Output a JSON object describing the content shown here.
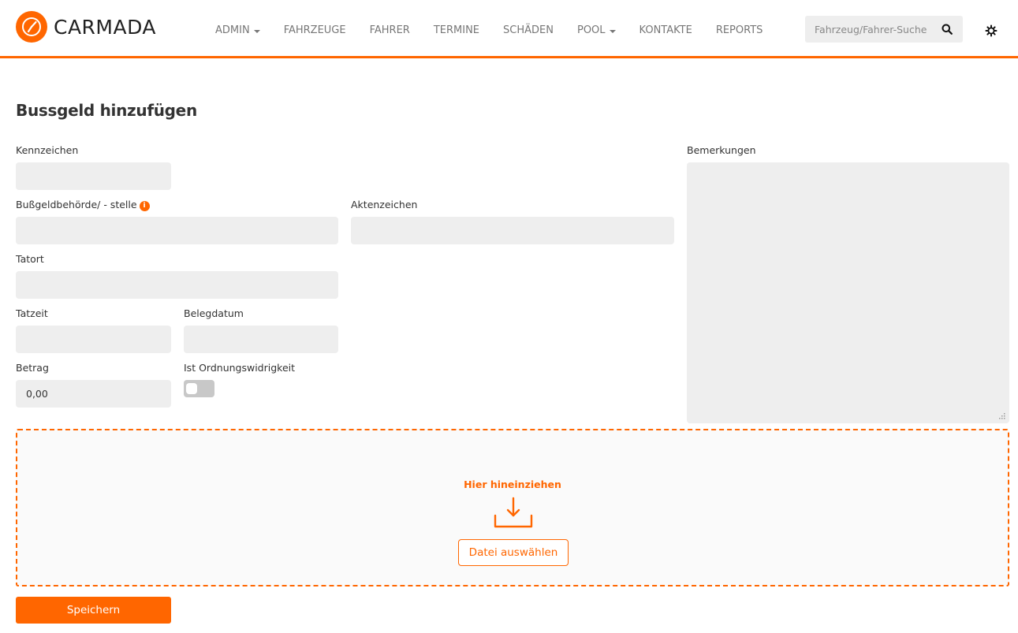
{
  "app": {
    "brand_name": "CARMADA",
    "accent_color": "#ff6600"
  },
  "nav": {
    "items": [
      {
        "label": "ADMIN",
        "dropdown": true
      },
      {
        "label": "FAHRZEUGE",
        "dropdown": false
      },
      {
        "label": "FAHRER",
        "dropdown": false
      },
      {
        "label": "TERMINE",
        "dropdown": false
      },
      {
        "label": "SCHÄDEN",
        "dropdown": false
      },
      {
        "label": "POOL",
        "dropdown": true
      },
      {
        "label": "KONTAKTE",
        "dropdown": false
      },
      {
        "label": "REPORTS",
        "dropdown": false
      }
    ]
  },
  "search": {
    "placeholder": "Fahrzeug/Fahrer-Suche",
    "value": "",
    "icon": "search-icon"
  },
  "settings": {
    "icon": "gear-icon"
  },
  "page": {
    "title": "Bussgeld hinzufügen"
  },
  "form": {
    "kennzeichen": {
      "label": "Kennzeichen",
      "value": ""
    },
    "behoerde": {
      "label": "Bußgeldbehörde/ - stelle",
      "value": "",
      "info_icon": "info-icon"
    },
    "aktenzeichen": {
      "label": "Aktenzeichen",
      "value": ""
    },
    "tatort": {
      "label": "Tatort",
      "value": ""
    },
    "tatzeit": {
      "label": "Tatzeit",
      "value": ""
    },
    "belegdatum": {
      "label": "Belegdatum",
      "value": ""
    },
    "betrag": {
      "label": "Betrag",
      "value": "0,00"
    },
    "ordnungswidrigkeit": {
      "label": "Ist Ordnungswidrigkeit",
      "checked": false
    },
    "bemerkungen": {
      "label": "Bemerkungen",
      "value": ""
    }
  },
  "dropzone": {
    "text": "Hier hineinziehen",
    "icon": "download-tray-icon",
    "button_label": "Datei auswählen"
  },
  "actions": {
    "save_label": "Speichern"
  }
}
